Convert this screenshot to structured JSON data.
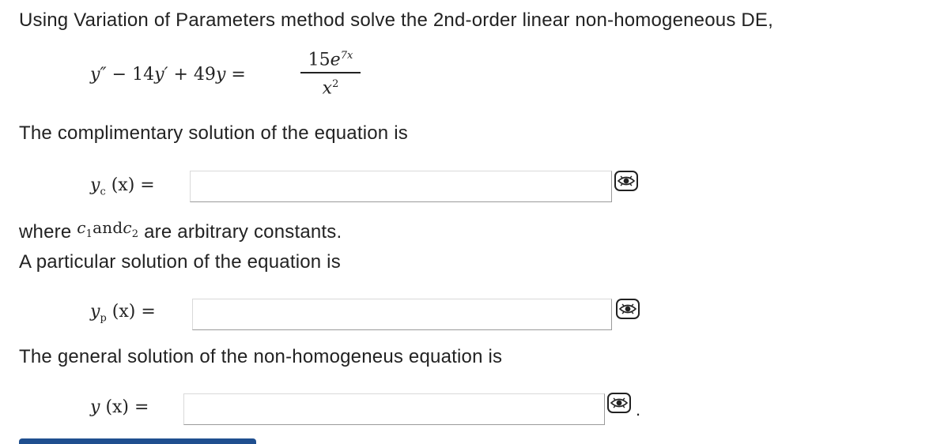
{
  "question": {
    "intro": "Using Variation of Parameters method solve the 2nd-order linear non-homogeneous DE,",
    "equation": {
      "lhs_y2": "y″",
      "lhs_minus": " − 14",
      "lhs_y1": "y′",
      "lhs_plus": " + 49",
      "lhs_y": "y",
      "equals": " =",
      "numerator_coeff": "15",
      "numerator_e": "e",
      "numerator_exp": "7x",
      "denominator_base": "x",
      "denominator_exp": "2"
    },
    "complementary_prompt": "The complimentary solution of the equation is",
    "yc_label": "y",
    "yc_sub": "c",
    "yc_arg": "(x)",
    "yc_equals": "=",
    "constants_where": "where",
    "constants_c1": "c",
    "constants_c1_sub": "1",
    "constants_and": "and",
    "constants_c2": "c",
    "constants_c2_sub": "2",
    "constants_rest": "are arbitrary constants.",
    "particular_prompt": "A particular solution of the equation is",
    "yp_label": "y",
    "yp_sub": "p",
    "yp_arg": "(x)",
    "yp_equals": "=",
    "general_prompt": "The general solution of the non-homogeneus equation is",
    "y_label": "y",
    "y_arg": "(x)",
    "y_equals": "=",
    "trailing_period": "."
  },
  "inputs": {
    "yc_value": "",
    "yp_value": "",
    "y_value": ""
  },
  "icons": {
    "preview": "eye-preview-icon"
  },
  "colors": {
    "text": "#222222",
    "box_border": "#9a9a9a",
    "bottom_bar": "#1f4f8f"
  }
}
